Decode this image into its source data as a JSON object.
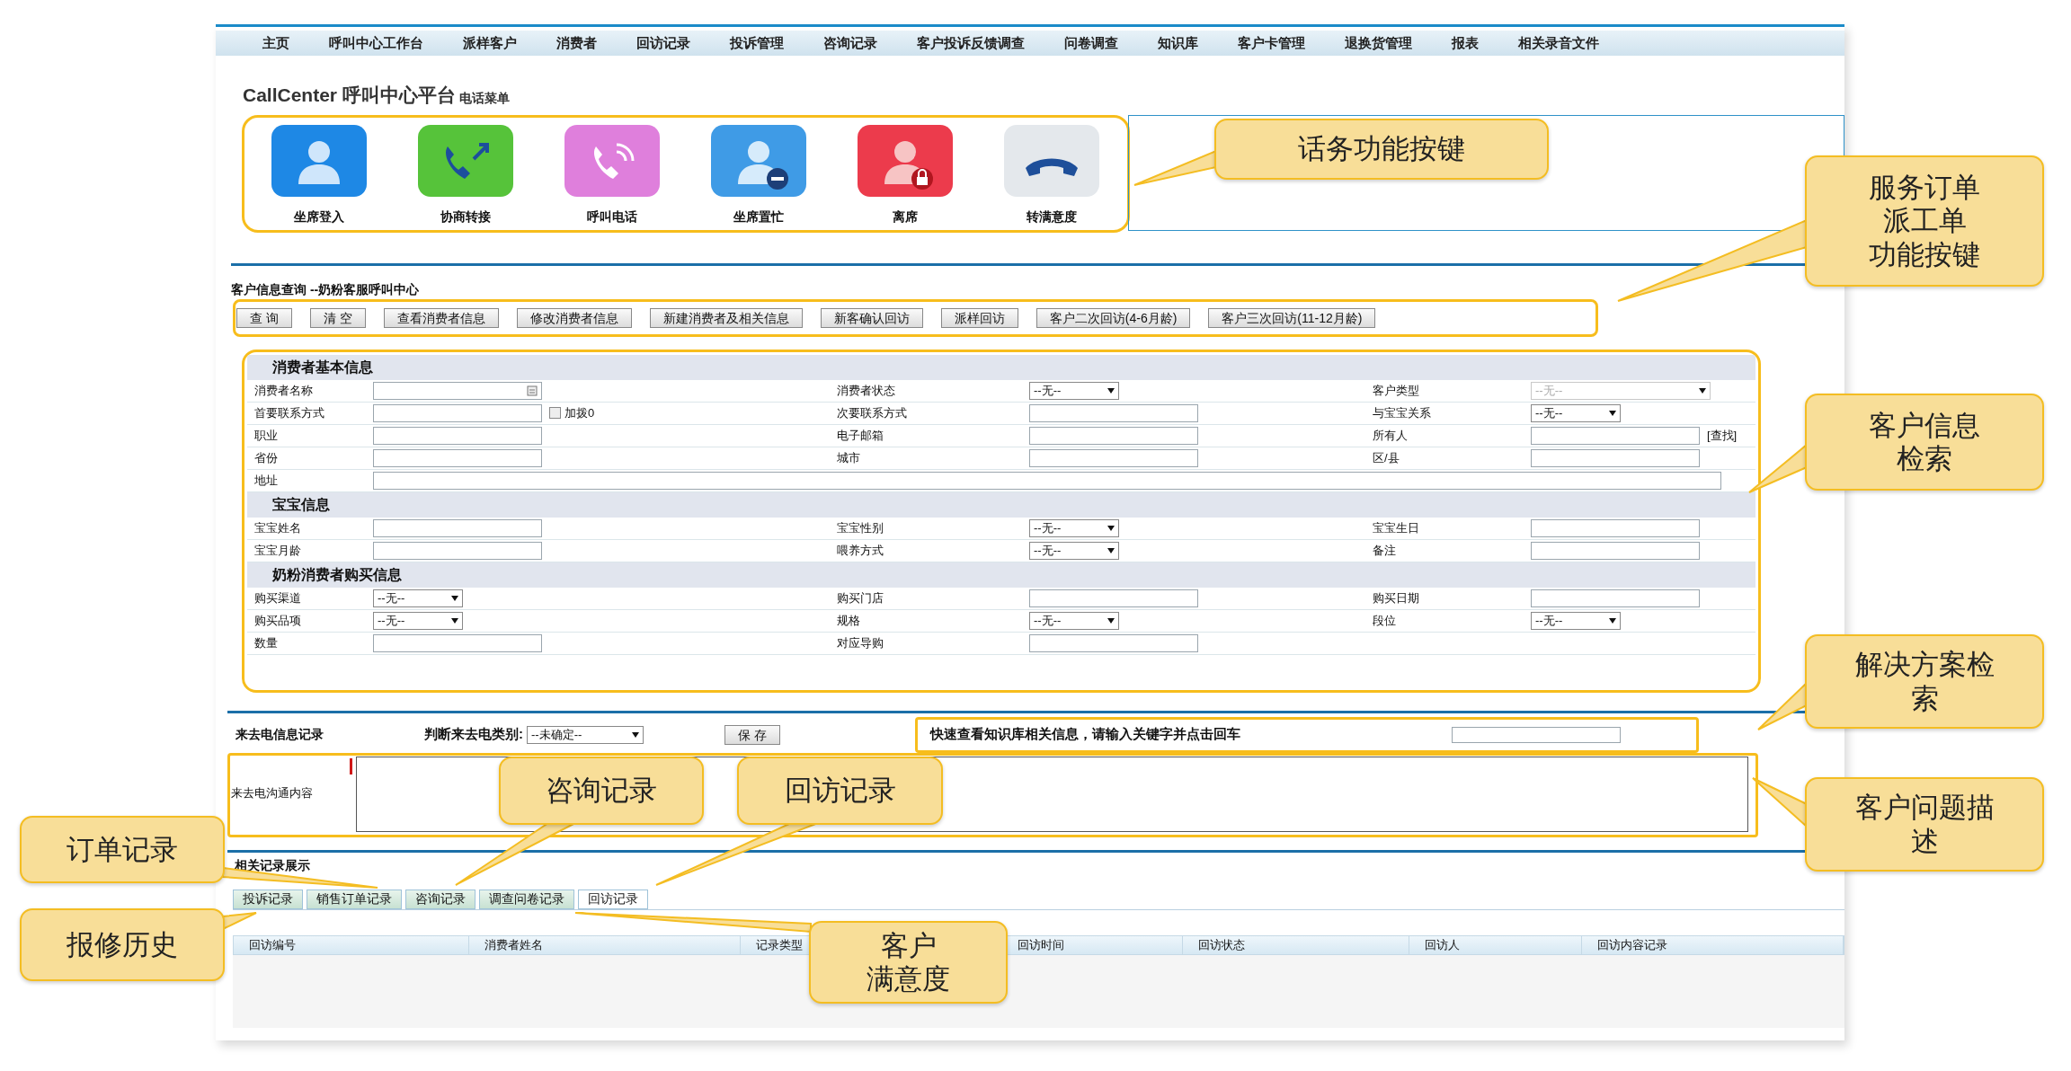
{
  "nav": {
    "items": [
      "主页",
      "呼叫中心工作台",
      "派样客户",
      "消费者",
      "回访记录",
      "投诉管理",
      "咨询记录",
      "客户投诉反馈调查",
      "问卷调查",
      "知识库",
      "客户卡管理",
      "退换货管理",
      "报表",
      "相关录音文件"
    ]
  },
  "header": {
    "title": "CallCenter 呼叫中心平台",
    "subtitle": "电话菜单"
  },
  "phone_buttons": [
    {
      "kind": "login",
      "label": "坐席登入"
    },
    {
      "kind": "transfer",
      "label": "协商转接"
    },
    {
      "kind": "call",
      "label": "呼叫电话"
    },
    {
      "kind": "busy",
      "label": "坐席置忙"
    },
    {
      "kind": "away",
      "label": "离席"
    },
    {
      "kind": "hangup",
      "label": "转满意度"
    }
  ],
  "query": {
    "title": "客户信息查询 --奶粉客服呼叫中心",
    "buttons": [
      "查 询",
      "清 空",
      "查看消费者信息",
      "修改消费者信息",
      "新建消费者及相关信息",
      "新客确认回访",
      "派样回访",
      "客户二次回访(4-6月龄)",
      "客户三次回访(11-12月龄)"
    ]
  },
  "form_sections": [
    {
      "title": "消费者基本信息",
      "rows": [
        [
          {
            "label": "消费者名称",
            "kind": "text_icon"
          },
          {
            "label": "消费者状态",
            "kind": "select",
            "value": "--无--"
          },
          {
            "label": "客户类型",
            "kind": "select",
            "value": "--无--",
            "disabled": true
          }
        ],
        [
          {
            "label": "首要联系方式",
            "kind": "text",
            "checkbox": {
              "label": "加拨0",
              "checked": false
            }
          },
          {
            "label": "次要联系方式",
            "kind": "text"
          },
          {
            "label": "与宝宝关系",
            "kind": "select",
            "value": "--无--"
          }
        ],
        [
          {
            "label": "职业",
            "kind": "text"
          },
          {
            "label": "电子邮箱",
            "kind": "text"
          },
          {
            "label": "所有人",
            "kind": "text",
            "link": "[查找]"
          }
        ],
        [
          {
            "label": "省份",
            "kind": "text"
          },
          {
            "label": "城市",
            "kind": "text"
          },
          {
            "label": "区/县",
            "kind": "text"
          }
        ],
        [
          {
            "label": "地址",
            "kind": "wide_text"
          }
        ]
      ]
    },
    {
      "title": "宝宝信息",
      "rows": [
        [
          {
            "label": "宝宝姓名",
            "kind": "text"
          },
          {
            "label": "宝宝性别",
            "kind": "select",
            "value": "--无--"
          },
          {
            "label": "宝宝生日",
            "kind": "text"
          }
        ],
        [
          {
            "label": "宝宝月龄",
            "kind": "text"
          },
          {
            "label": "喂养方式",
            "kind": "select",
            "value": "--无--"
          },
          {
            "label": "备注",
            "kind": "text"
          }
        ]
      ]
    },
    {
      "title": "奶粉消费者购买信息",
      "rows": [
        [
          {
            "label": "购买渠道",
            "kind": "select",
            "value": "--无--"
          },
          {
            "label": "购买门店",
            "kind": "text"
          },
          {
            "label": "购买日期",
            "kind": "text"
          }
        ],
        [
          {
            "label": "购买品项",
            "kind": "select",
            "value": "--无--"
          },
          {
            "label": "规格",
            "kind": "select",
            "value": "--无--"
          },
          {
            "label": "段位",
            "kind": "select",
            "value": "--无--"
          }
        ],
        [
          {
            "label": "数量",
            "kind": "text"
          },
          {
            "label": "对应导购",
            "kind": "text"
          }
        ]
      ]
    }
  ],
  "call_record": {
    "title": "来去电信息记录",
    "category_label": "判断来去电类别:",
    "category_value": "--未确定--",
    "save_button": "保 存",
    "search_label": "快速查看知识库相关信息，请输入关键字并点击回车",
    "content_label": "来去电沟通内容"
  },
  "related": {
    "title": "相关记录展示",
    "tabs": [
      {
        "label": "投诉记录",
        "selected": false
      },
      {
        "label": "销售订单记录",
        "selected": false
      },
      {
        "label": "咨询记录",
        "selected": false
      },
      {
        "label": "调查问卷记录",
        "selected": false
      },
      {
        "label": "回访记录",
        "selected": true
      }
    ],
    "columns": [
      "回访编号",
      "消费者姓名",
      "记录类型",
      "回访时间",
      "回访状态",
      "回访人",
      "回访内容记录"
    ]
  },
  "callouts": [
    {
      "lines": [
        "话务功能按键"
      ]
    },
    {
      "lines": [
        "服务订单",
        "派工单",
        "功能按键"
      ]
    },
    {
      "lines": [
        "客户信息",
        "检索"
      ]
    },
    {
      "lines": [
        "解决方案检",
        "索"
      ]
    },
    {
      "lines": [
        "客户问题描",
        "述"
      ]
    },
    {
      "lines": [
        "咨询记录"
      ]
    },
    {
      "lines": [
        "回访记录"
      ]
    },
    {
      "lines": [
        "订单记录"
      ]
    },
    {
      "lines": [
        "报修历史"
      ]
    },
    {
      "lines": [
        "客户",
        "满意度"
      ]
    }
  ]
}
